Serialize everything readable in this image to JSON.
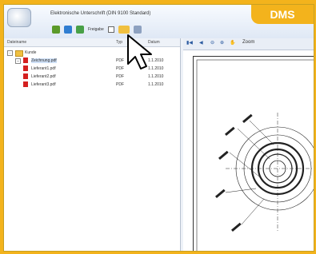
{
  "window": {
    "title": "Elektronische Unterschrift (DIN 9100 Standard)"
  },
  "badge": {
    "label": "DMS"
  },
  "ribbon": {
    "sign_label": "Freigabe"
  },
  "tree": {
    "columns": {
      "name": "Dateiname",
      "type": "Typ",
      "date": "Datum"
    },
    "root": {
      "label": "Kunde"
    },
    "items": [
      {
        "label": "Zeichnung.pdf",
        "type": "PDF",
        "date": "1.1.2010"
      },
      {
        "label": "Lieferant1.pdf",
        "type": "PDF",
        "date": "1.1.2010"
      },
      {
        "label": "Lieferant2.pdf",
        "type": "PDF",
        "date": "1.1.2010"
      },
      {
        "label": "Lieferant3.pdf",
        "type": "PDF",
        "date": "1.1.2010"
      }
    ]
  },
  "viewer": {
    "toolbar": {
      "zoom_label": "Zoom"
    }
  },
  "colors": {
    "frame": "#f3b31c",
    "pdf": "#d42020",
    "selection": "#cfe0f6"
  }
}
